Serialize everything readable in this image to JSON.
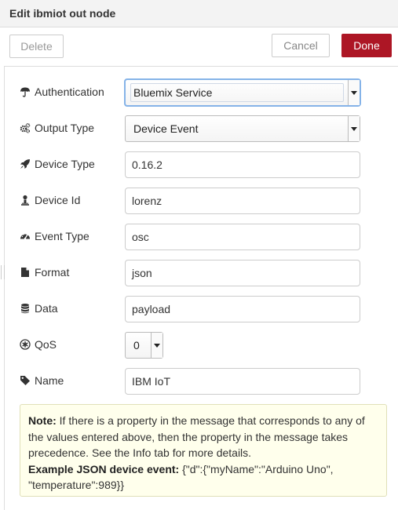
{
  "dialog": {
    "title": "Edit ibmiot out node",
    "delete_label": "Delete",
    "cancel_label": "Cancel",
    "done_label": "Done",
    "accent_color": "#ad1625"
  },
  "form": {
    "authentication": {
      "label": "Authentication",
      "value": "Bluemix Service",
      "icon": "umbrella-icon"
    },
    "output_type": {
      "label": "Output Type",
      "value": "Device Event",
      "icon": "cogs-icon"
    },
    "device_type": {
      "label": "Device Type",
      "value": "0.16.2",
      "icon": "rocket-icon"
    },
    "device_id": {
      "label": "Device Id",
      "value": "lorenz",
      "icon": "user-icon"
    },
    "event_type": {
      "label": "Event Type",
      "value": "osc",
      "icon": "dashboard-icon"
    },
    "format": {
      "label": "Format",
      "value": "json",
      "icon": "file-icon"
    },
    "data": {
      "label": "Data",
      "value": "payload",
      "icon": "database-icon"
    },
    "qos": {
      "label": "QoS",
      "value": "0",
      "icon": "asterisk-icon"
    },
    "name": {
      "label": "Name",
      "value": "IBM IoT",
      "icon": "tag-icon"
    }
  },
  "note": {
    "note_label": "Note:",
    "note_text": " If there is a property in the message that corresponds to any of the values entered above, then the property in the message takes precedence. See the Info tab for more details.",
    "example_label": "Example JSON device event:",
    "example_text": " {\"d\":{\"myName\":\"Arduino Uno\", \"temperature\":989}}"
  }
}
